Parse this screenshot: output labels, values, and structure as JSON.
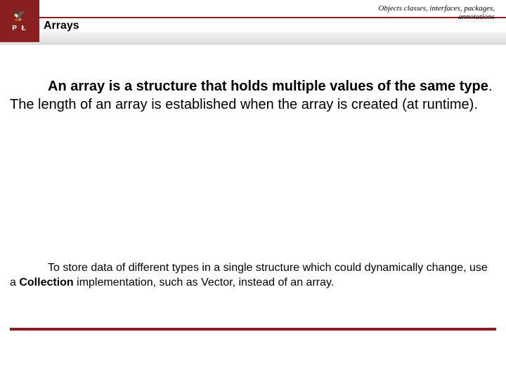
{
  "header": {
    "logo_top_glyph": "🦅",
    "logo_letters": "P Ł",
    "breadcrumb_line1": "Objects classes, interfaces, packages,",
    "breadcrumb_line2": "annotations",
    "title": "Arrays"
  },
  "body": {
    "p1_lead_bold": "An array is a structure that holds multiple values of the same type",
    "p1_rest": ". The length of an array is established when the array is created (at runtime).",
    "p2_pre": "To store data of different types in a single structure which could dynamically change,  use a ",
    "p2_bold": "Collection",
    "p2_post": " implementation, such as Vector, instead of an array."
  },
  "colors": {
    "brand": "#8a1f1f"
  }
}
